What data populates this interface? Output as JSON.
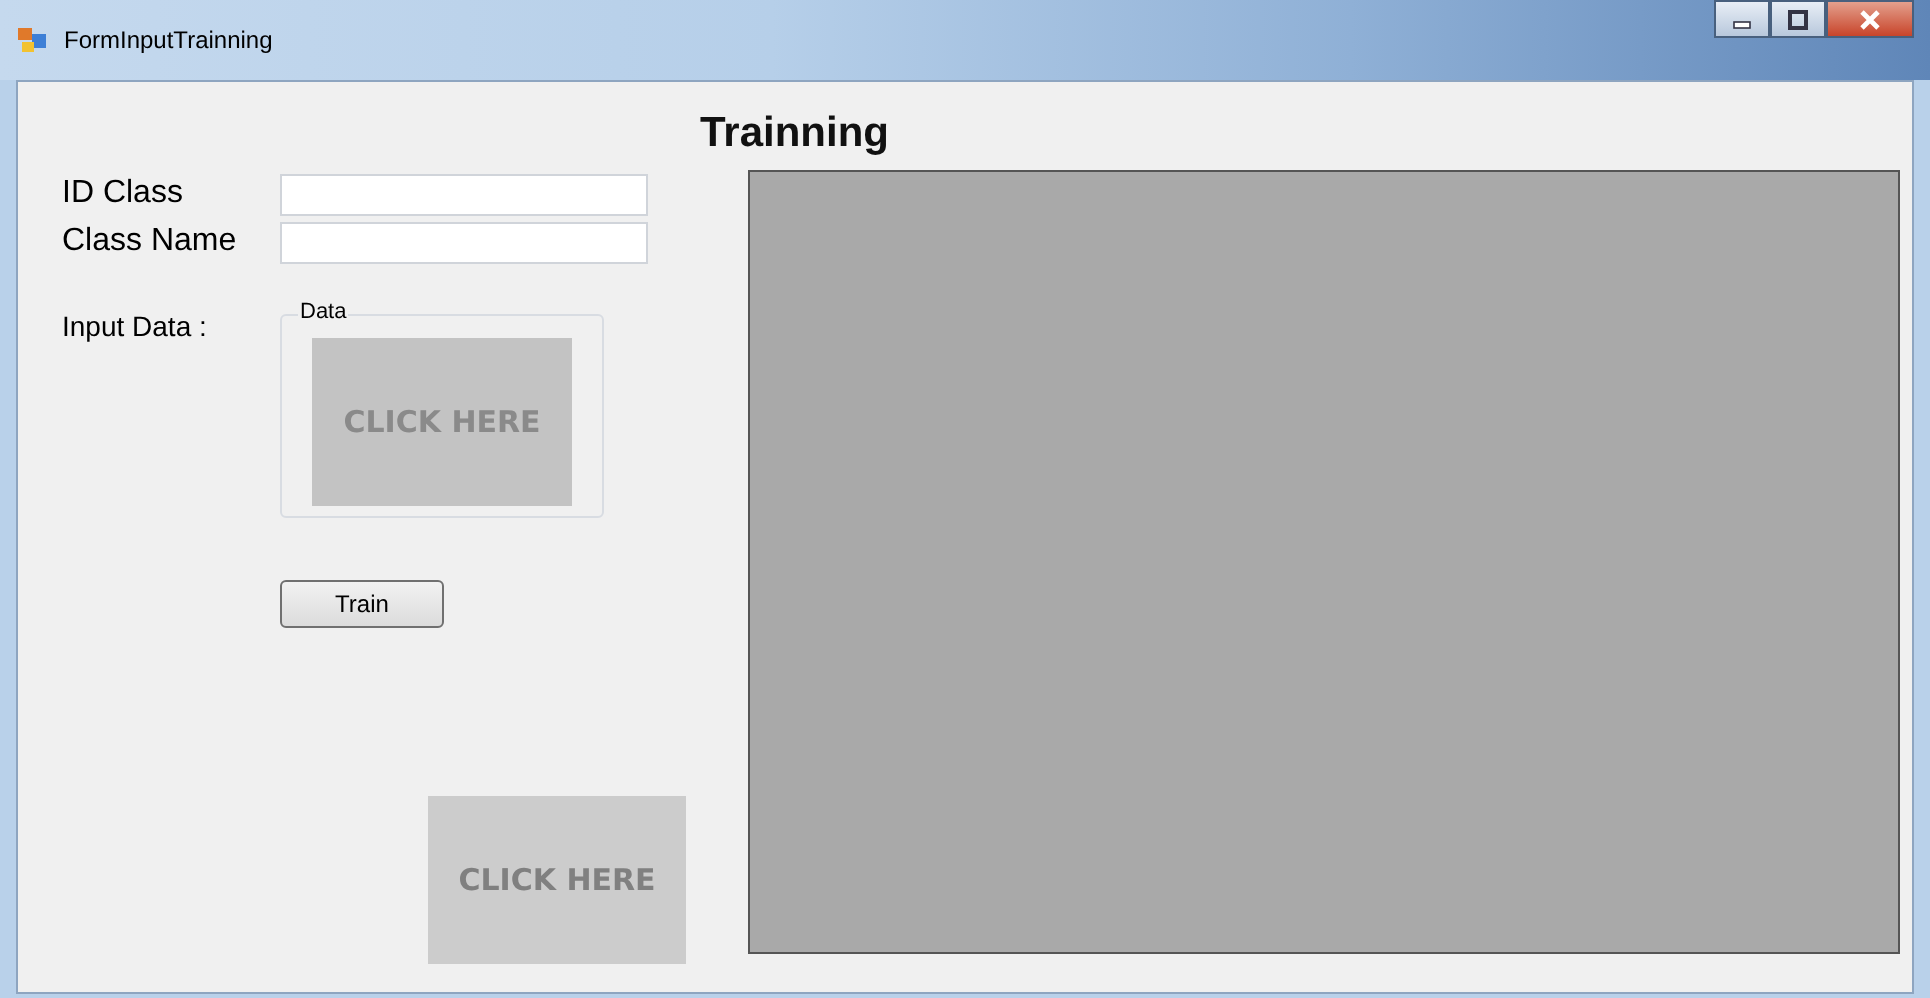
{
  "window": {
    "title": "FormInputTrainning"
  },
  "heading": "Trainning",
  "fields": [
    {
      "label": "ID Class"
    },
    {
      "label": "Class Name"
    }
  ],
  "input_data": {
    "label": "Input Data :",
    "group_title": "Data",
    "image_button": "CLICK HERE"
  },
  "buttons": [
    "Train"
  ],
  "lower_image_button": "CLICK HERE"
}
